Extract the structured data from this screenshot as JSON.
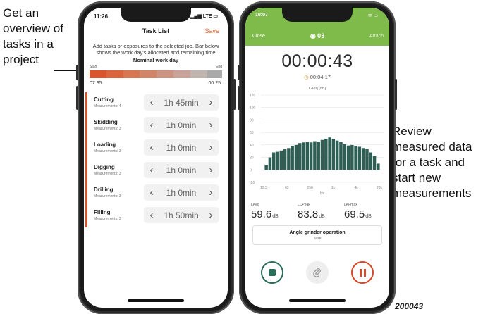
{
  "annotations": {
    "left_lines": [
      "Get an",
      "overview of",
      "tasks in a",
      "project"
    ],
    "right_lines": [
      "Review",
      "measured data",
      "for a task and",
      "start new",
      "measurements"
    ],
    "figure_id": "200043"
  },
  "task_list": {
    "status_time": "11:26",
    "status_network": "LTE",
    "title": "Task List",
    "save_label": "Save",
    "description": "Add tasks or exposures to the selected job. Bar below shows the work day's allocated and remaining time",
    "nominal_label": "Nominal work day",
    "bar_start_label": "Start",
    "bar_end_label": "End",
    "start_time": "07:35",
    "end_time": "00:25",
    "allocated_colors": [
      "#d9542a",
      "#d9643e",
      "#d67652",
      "#d18568",
      "#cc9480",
      "#c8a296",
      "#bfb4ae"
    ],
    "remaining_color": "#a9a9a9",
    "tasks": [
      {
        "name": "Cutting",
        "measurements": "Measurements: 4",
        "duration": "1h 45min"
      },
      {
        "name": "Skidding",
        "measurements": "Measurements: 3",
        "duration": "1h 0min"
      },
      {
        "name": "Loading",
        "measurements": "Measurements: 3",
        "duration": "1h 0min"
      },
      {
        "name": "Digging",
        "measurements": "Measurements: 3",
        "duration": "1h 0min"
      },
      {
        "name": "Drilling",
        "measurements": "Measurements: 3",
        "duration": "1h 0min"
      },
      {
        "name": "Filling",
        "measurements": "Measurements: 3",
        "duration": "1h 50min"
      }
    ]
  },
  "measurement": {
    "status_time": "10:07",
    "close_label": "Close",
    "measurement_number": "03",
    "attach_label": "Attach",
    "timer": "00:00:43",
    "elapsed": "00:04:17",
    "accent_color": "#7ebb4a",
    "bar_color": "#2f5e55",
    "readouts": [
      {
        "label": "LAeq",
        "value": "59.6",
        "unit": "dB"
      },
      {
        "label": "LCPeak",
        "value": "83.8",
        "unit": "dB"
      },
      {
        "label": "LAFmax",
        "value": "69.5",
        "unit": "dB"
      }
    ],
    "task_card": {
      "name": "Angle grinder operation",
      "sub": "Task"
    }
  },
  "chart_data": {
    "type": "bar",
    "title": "LAeq [dB]",
    "xlabel": "Hz",
    "ylabel": "",
    "ylim": [
      -20,
      120
    ],
    "y_ticks": [
      120,
      100,
      80,
      60,
      40,
      20,
      0,
      -20
    ],
    "x_tick_labels": [
      "12.5",
      "63",
      "250",
      "1k",
      "4k",
      "20k"
    ],
    "values": [
      8,
      20,
      28,
      29,
      31,
      33,
      35,
      38,
      40,
      43,
      44,
      45,
      44,
      46,
      45,
      48,
      50,
      52,
      50,
      47,
      45,
      41,
      39,
      40,
      38,
      37,
      35,
      34,
      28,
      22,
      10
    ]
  }
}
